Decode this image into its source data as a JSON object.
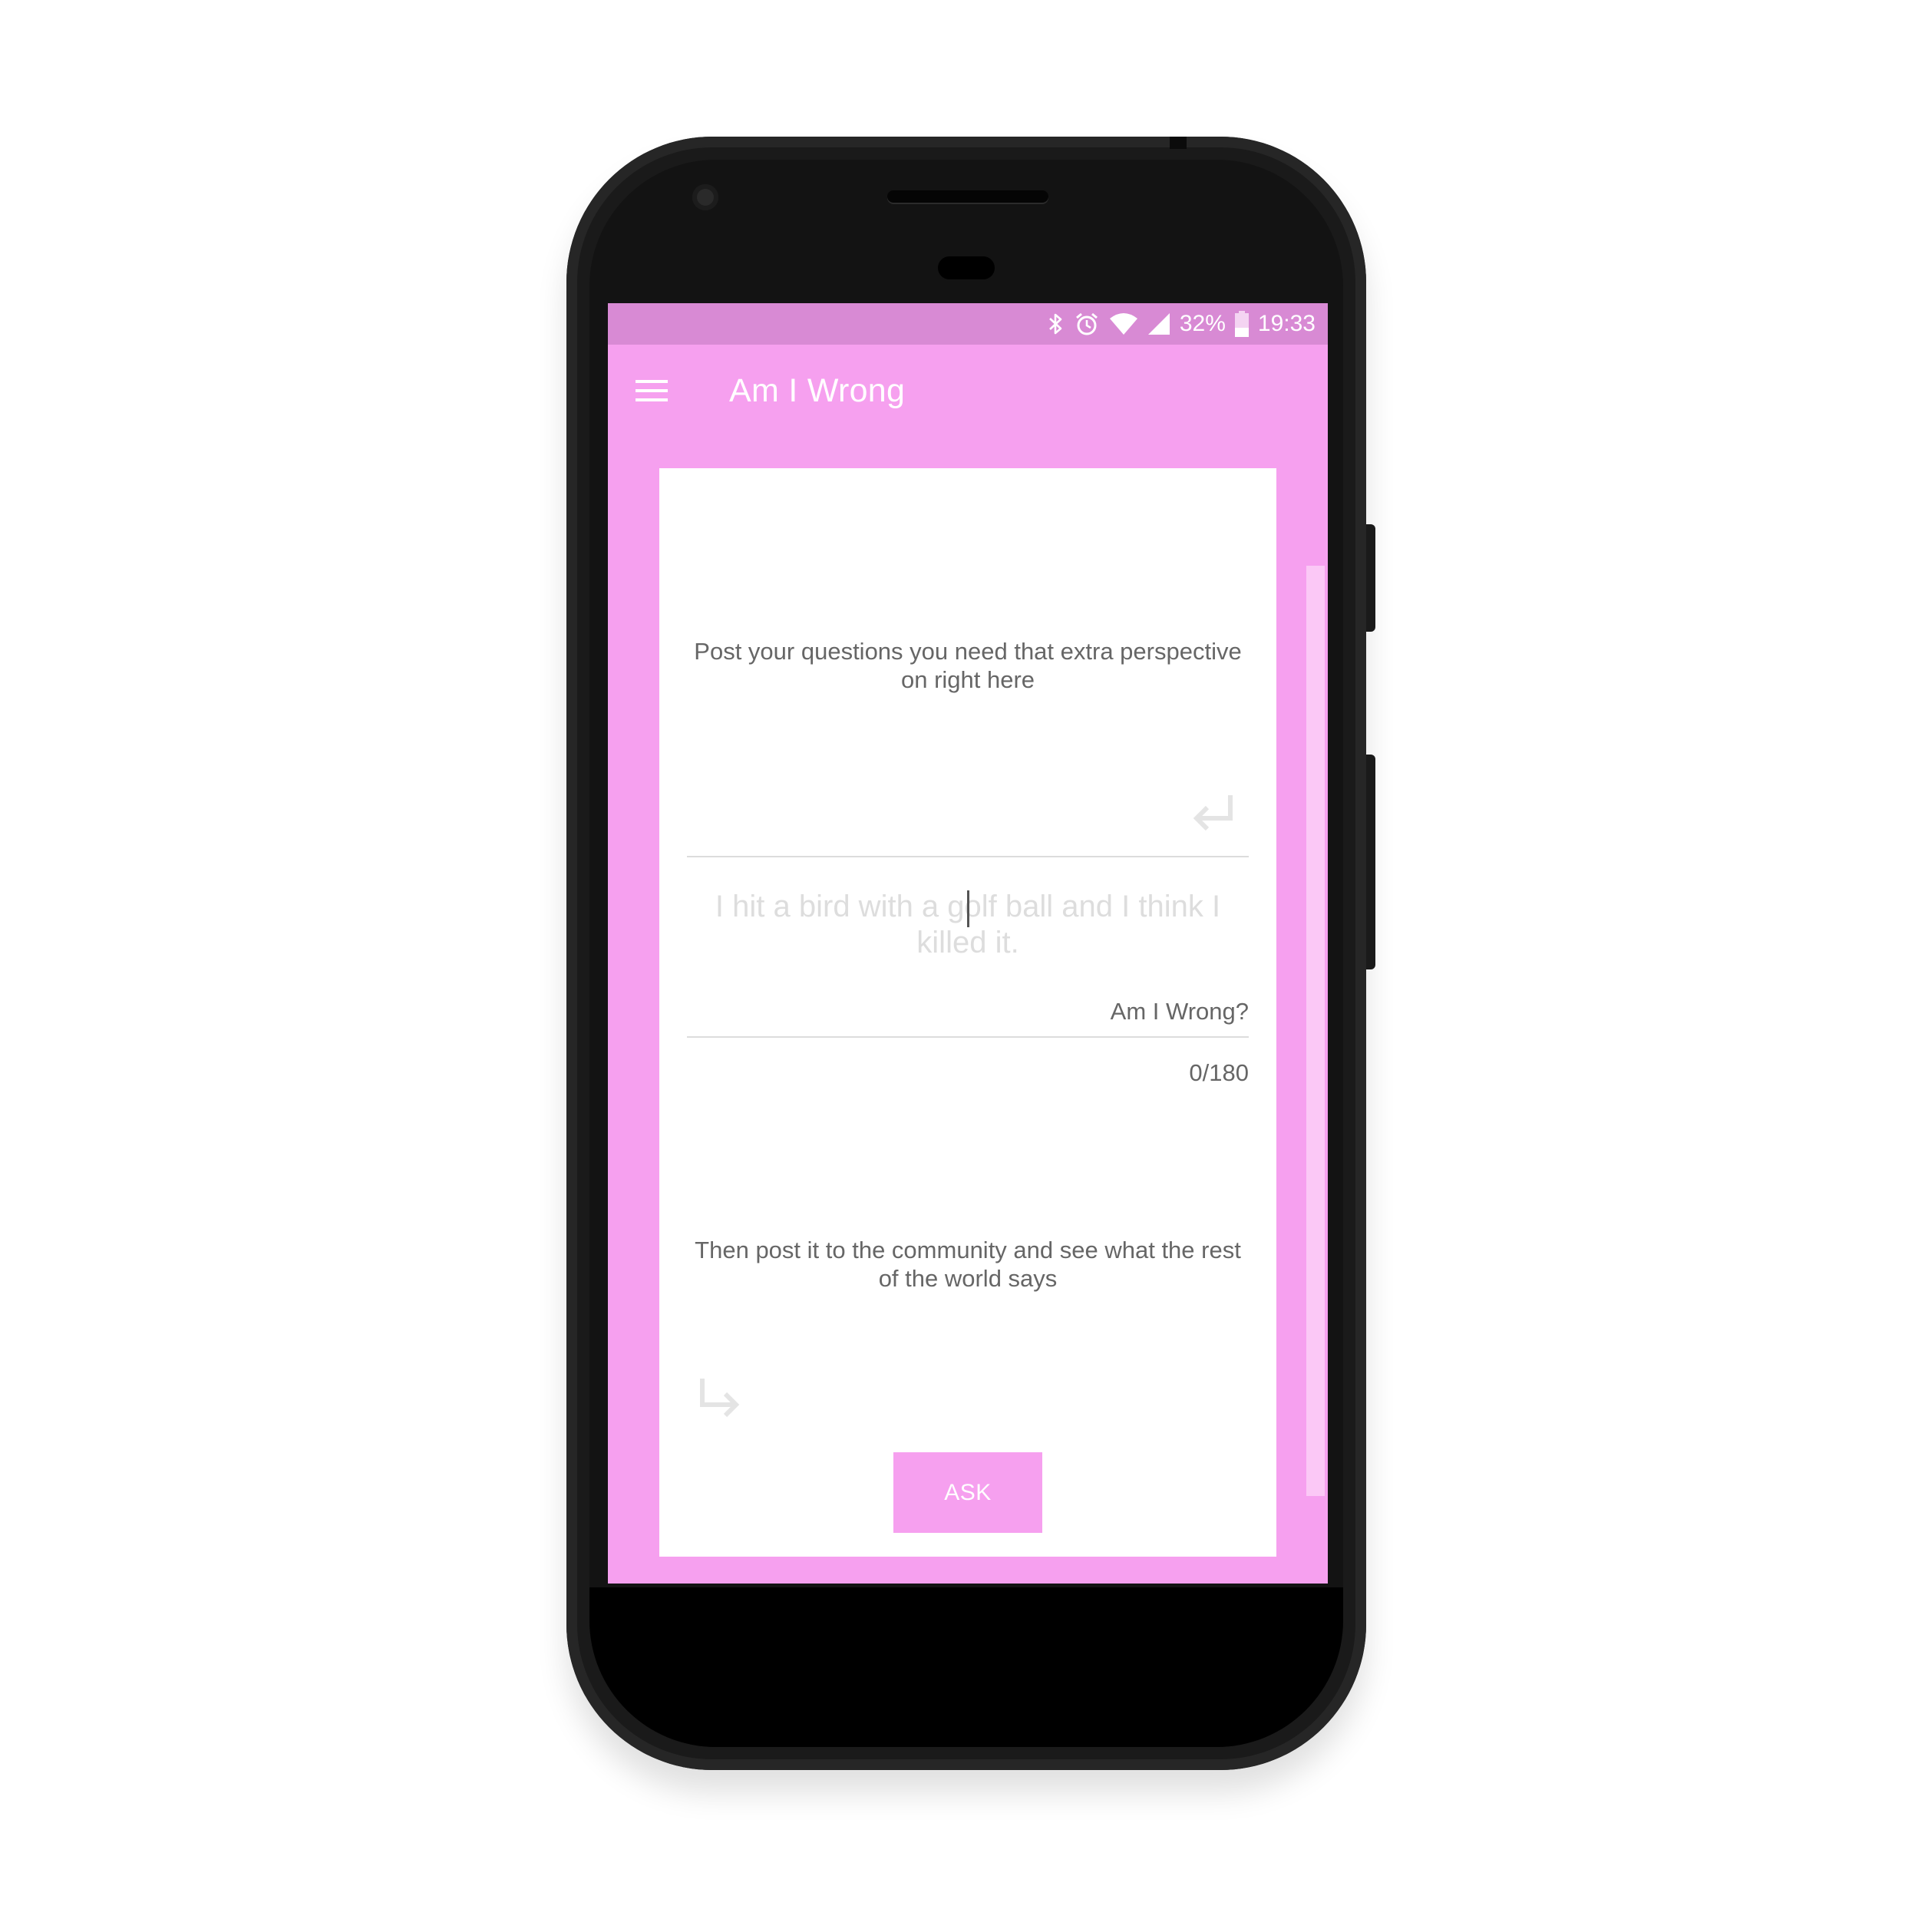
{
  "status_bar": {
    "battery": "32%",
    "time": "19:33",
    "icons": [
      "bluetooth-icon",
      "alarm-icon",
      "wifi-icon",
      "cell-signal-icon",
      "battery-icon"
    ]
  },
  "app_bar": {
    "title": "Am I Wrong",
    "menu_icon": "hamburger-menu-icon"
  },
  "card": {
    "intro_text": "Post your questions you need that extra perspective on right here",
    "question_placeholder": "I hit a bird with a golf ball and I think I killed it.",
    "suffix_label": "Am I Wrong?",
    "char_counter": "0/180",
    "cta_text": "Then post it to the community and see what the rest of the world says",
    "ask_button": "ASK",
    "return_icon": "keyboard-return-icon",
    "subdirectory_icon": "subdirectory-arrow-right-icon"
  },
  "colors": {
    "primary": "#f6a0ef",
    "status_bar": "#d88ad4",
    "card": "#ffffff",
    "text_muted": "#666666",
    "placeholder": "#dddddd"
  }
}
